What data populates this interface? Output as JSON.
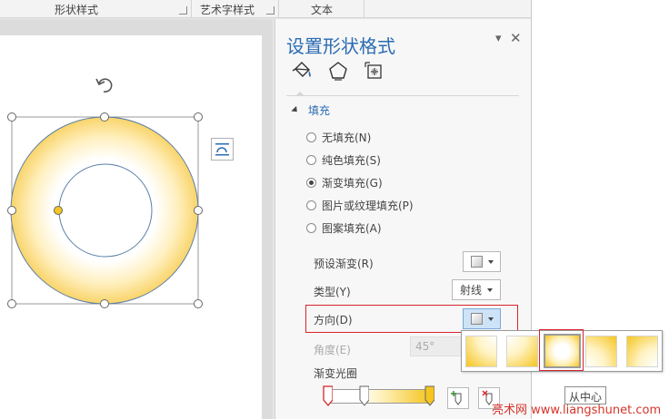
{
  "ribbon": {
    "shape_styles": "形状样式",
    "wordart_styles": "艺术字样式",
    "text": "文本"
  },
  "pane": {
    "title": "设置形状格式",
    "tabs": [
      {
        "name": "fill-line",
        "icon": "paint-bucket-icon"
      },
      {
        "name": "effects",
        "icon": "pentagon-icon"
      },
      {
        "name": "size-properties",
        "icon": "size-layout-icon"
      }
    ],
    "section_fill": "填充",
    "fill_options": [
      {
        "label": "无填充(N)",
        "selected": false
      },
      {
        "label": "纯色填充(S)",
        "selected": false
      },
      {
        "label": "渐变填充(G)",
        "selected": true
      },
      {
        "label": "图片或纹理填充(P)",
        "selected": false
      },
      {
        "label": "图案填充(A)",
        "selected": false
      }
    ],
    "preset_gradient_label": "预设渐变(R)",
    "type_label": "类型(Y)",
    "type_value": "射线",
    "direction_label": "方向(D)",
    "angle_label": "角度(E)",
    "angle_value": "45°",
    "gradient_stops_label": "渐变光圈"
  },
  "gallery": {
    "tooltip": "从中心",
    "selected_index": 2
  },
  "watermark": "亮术网 www.liangshunet.com",
  "colors": {
    "accent": "#2a6bb3",
    "highlight": "#d9232d",
    "gradient_gold": "#f5c520"
  }
}
